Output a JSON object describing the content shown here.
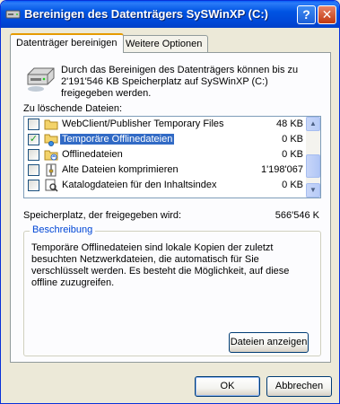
{
  "window": {
    "title": "Bereinigen des Datenträgers SySWinXP (C:)",
    "help_label": "?",
    "close_label": "✕"
  },
  "tabs": [
    {
      "label": "Datenträger bereinigen",
      "active": true
    },
    {
      "label": "Weitere Optionen",
      "active": false
    }
  ],
  "intro_text": "Durch das Bereinigen des Datenträgers können bis zu 2'191'546 KB Speicherplatz auf SySWinXP (C:) freigegeben werden.",
  "files_label": "Zu löschende Dateien:",
  "files": [
    {
      "name": "WebClient/Publisher Temporary Files",
      "size": "48 KB",
      "checked": false,
      "icon": "folder-icon"
    },
    {
      "name": "Temporäre Offlinedateien",
      "size": "0 KB",
      "checked": true,
      "selected": true,
      "icon": "network-folder-icon"
    },
    {
      "name": "Offlinedateien",
      "size": "0 KB",
      "checked": false,
      "icon": "offline-files-icon"
    },
    {
      "name": "Alte Dateien komprimieren",
      "size": "1'198'067",
      "checked": false,
      "icon": "compress-icon"
    },
    {
      "name": "Katalogdateien für den Inhaltsindex",
      "size": "0 KB",
      "checked": false,
      "icon": "catalog-icon"
    }
  ],
  "space_label": "Speicherplatz, der freigegeben wird:",
  "space_value": "566'546 K",
  "description": {
    "title": "Beschreibung",
    "text": "Temporäre Offlinedateien sind lokale Kopien der zuletzt besuchten Netzwerkdateien, die automatisch für Sie verschlüsselt werden. Es besteht die Möglichkeit, auf diese offline zuzugreifen."
  },
  "buttons": {
    "view_files": "Dateien anzeigen",
    "ok": "OK",
    "cancel": "Abbrechen"
  },
  "colors": {
    "titlebar": "#0054e3",
    "selection": "#316ac5",
    "group_title": "#0046d5"
  }
}
